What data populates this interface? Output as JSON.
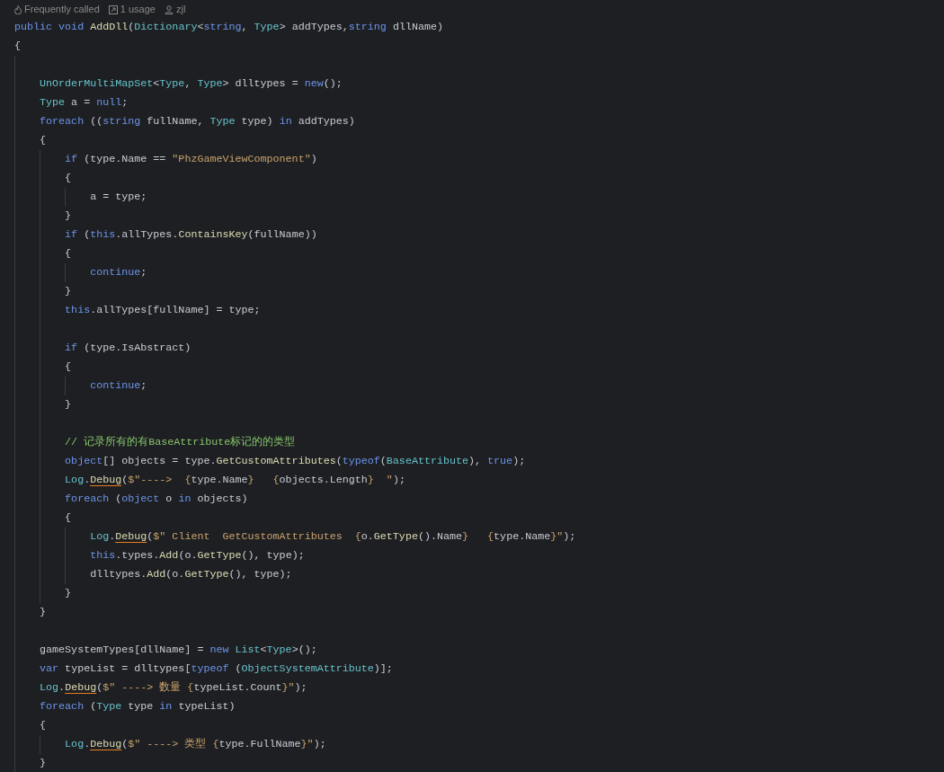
{
  "hints": [
    {
      "text": "Frequently called"
    },
    {
      "text": "1 usage"
    },
    {
      "text": "zjl"
    }
  ],
  "lines": [
    {
      "kind": "code",
      "tokens": [
        {
          "text": "public void ",
          "kind": "keyword"
        },
        {
          "text": "AddDll",
          "kind": "method"
        },
        {
          "text": "(",
          "kind": "plain"
        },
        {
          "text": "Dictionary",
          "kind": "type"
        },
        {
          "text": "<",
          "kind": "plain"
        },
        {
          "text": "string",
          "kind": "keyword"
        },
        {
          "text": ", ",
          "kind": "plain"
        },
        {
          "text": "Type",
          "kind": "type"
        },
        {
          "text": "> addTypes,",
          "kind": "plain"
        },
        {
          "text": "string",
          "kind": "keyword"
        },
        {
          "text": " dllName)",
          "kind": "plain"
        }
      ]
    },
    {
      "kind": "code",
      "tokens": [
        {
          "text": "{",
          "kind": "plain"
        }
      ]
    },
    {
      "kind": "blank"
    },
    {
      "kind": "code",
      "tokens": [
        {
          "text": "    UnOrderMultiMapSet",
          "kind": "type"
        },
        {
          "text": "<",
          "kind": "plain"
        },
        {
          "text": "Type",
          "kind": "type"
        },
        {
          "text": ", ",
          "kind": "plain"
        },
        {
          "text": "Type",
          "kind": "type"
        },
        {
          "text": "> dlltypes = ",
          "kind": "plain"
        },
        {
          "text": "new",
          "kind": "keyword"
        },
        {
          "text": "();",
          "kind": "plain"
        }
      ]
    },
    {
      "kind": "code",
      "tokens": [
        {
          "text": "    Type",
          "kind": "type"
        },
        {
          "text": " a = ",
          "kind": "plain"
        },
        {
          "text": "null",
          "kind": "keyword"
        },
        {
          "text": ";",
          "kind": "plain"
        }
      ]
    },
    {
      "kind": "code",
      "tokens": [
        {
          "text": "    foreach",
          "kind": "keyword"
        },
        {
          "text": " ((",
          "kind": "plain"
        },
        {
          "text": "string",
          "kind": "keyword"
        },
        {
          "text": " fullName, ",
          "kind": "plain"
        },
        {
          "text": "Type",
          "kind": "type"
        },
        {
          "text": " type) ",
          "kind": "plain"
        },
        {
          "text": "in",
          "kind": "keyword"
        },
        {
          "text": " addTypes)",
          "kind": "plain"
        }
      ]
    },
    {
      "kind": "code",
      "tokens": [
        {
          "text": "    {",
          "kind": "plain"
        }
      ]
    },
    {
      "kind": "code",
      "tokens": [
        {
          "text": "        if",
          "kind": "keyword"
        },
        {
          "text": " (type.Name == ",
          "kind": "plain"
        },
        {
          "text": "\"PhzGameViewComponent\"",
          "kind": "string"
        },
        {
          "text": ")",
          "kind": "plain"
        }
      ]
    },
    {
      "kind": "code",
      "tokens": [
        {
          "text": "        {",
          "kind": "plain"
        }
      ]
    },
    {
      "kind": "code",
      "tokens": [
        {
          "text": "            a = type;",
          "kind": "plain"
        }
      ]
    },
    {
      "kind": "code",
      "tokens": [
        {
          "text": "        }",
          "kind": "plain"
        }
      ]
    },
    {
      "kind": "code",
      "tokens": [
        {
          "text": "        if",
          "kind": "keyword"
        },
        {
          "text": " (",
          "kind": "plain"
        },
        {
          "text": "this",
          "kind": "keyword"
        },
        {
          "text": ".allTypes.",
          "kind": "plain"
        },
        {
          "text": "ContainsKey",
          "kind": "method"
        },
        {
          "text": "(fullName))",
          "kind": "plain"
        }
      ]
    },
    {
      "kind": "code",
      "tokens": [
        {
          "text": "        {",
          "kind": "plain"
        }
      ]
    },
    {
      "kind": "code",
      "tokens": [
        {
          "text": "            continue",
          "kind": "keyword"
        },
        {
          "text": ";",
          "kind": "plain"
        }
      ]
    },
    {
      "kind": "code",
      "tokens": [
        {
          "text": "        }",
          "kind": "plain"
        }
      ]
    },
    {
      "kind": "code",
      "tokens": [
        {
          "text": "        this",
          "kind": "keyword"
        },
        {
          "text": ".allTypes[fullName] = type;",
          "kind": "plain"
        }
      ]
    },
    {
      "kind": "blank"
    },
    {
      "kind": "code",
      "tokens": [
        {
          "text": "        if",
          "kind": "keyword"
        },
        {
          "text": " (type.IsAbstract)",
          "kind": "plain"
        }
      ]
    },
    {
      "kind": "code",
      "tokens": [
        {
          "text": "        {",
          "kind": "plain"
        }
      ]
    },
    {
      "kind": "code",
      "tokens": [
        {
          "text": "            continue",
          "kind": "keyword"
        },
        {
          "text": ";",
          "kind": "plain"
        }
      ]
    },
    {
      "kind": "code",
      "tokens": [
        {
          "text": "        }",
          "kind": "plain"
        }
      ]
    },
    {
      "kind": "blank"
    },
    {
      "kind": "code",
      "tokens": [
        {
          "text": "        // 记录所有的有BaseAttribute标记的的类型",
          "kind": "comment"
        }
      ]
    },
    {
      "kind": "code",
      "tokens": [
        {
          "text": "        object",
          "kind": "keyword"
        },
        {
          "text": "[] objects = type.",
          "kind": "plain"
        },
        {
          "text": "GetCustomAttributes",
          "kind": "method"
        },
        {
          "text": "(",
          "kind": "plain"
        },
        {
          "text": "typeof",
          "kind": "keyword"
        },
        {
          "text": "(",
          "kind": "plain"
        },
        {
          "text": "BaseAttribute",
          "kind": "type"
        },
        {
          "text": "), ",
          "kind": "plain"
        },
        {
          "text": "true",
          "kind": "keyword"
        },
        {
          "text": ");",
          "kind": "plain"
        }
      ]
    },
    {
      "kind": "code",
      "tokens": [
        {
          "text": "        Log",
          "kind": "type"
        },
        {
          "text": ".",
          "kind": "plain"
        },
        {
          "text": "Debug",
          "kind": "method",
          "warning": true
        },
        {
          "text": "(",
          "kind": "plain"
        },
        {
          "text": "$\"---->  {",
          "kind": "string"
        },
        {
          "text": "type.Name",
          "kind": "plain"
        },
        {
          "text": "}   {",
          "kind": "string"
        },
        {
          "text": "objects.Length",
          "kind": "plain"
        },
        {
          "text": "}  \"",
          "kind": "string"
        },
        {
          "text": ");",
          "kind": "plain"
        }
      ]
    },
    {
      "kind": "code",
      "tokens": [
        {
          "text": "        foreach",
          "kind": "keyword"
        },
        {
          "text": " (",
          "kind": "plain"
        },
        {
          "text": "object",
          "kind": "keyword"
        },
        {
          "text": " o ",
          "kind": "plain"
        },
        {
          "text": "in",
          "kind": "keyword"
        },
        {
          "text": " objects)",
          "kind": "plain"
        }
      ]
    },
    {
      "kind": "code",
      "tokens": [
        {
          "text": "        {",
          "kind": "plain"
        }
      ]
    },
    {
      "kind": "code",
      "tokens": [
        {
          "text": "            Log",
          "kind": "type"
        },
        {
          "text": ".",
          "kind": "plain"
        },
        {
          "text": "Debug",
          "kind": "method",
          "warning": true
        },
        {
          "text": "(",
          "kind": "plain"
        },
        {
          "text": "$\" Client  GetCustomAttributes  {",
          "kind": "string"
        },
        {
          "text": "o.",
          "kind": "plain"
        },
        {
          "text": "GetType",
          "kind": "method"
        },
        {
          "text": "().Name",
          "kind": "plain"
        },
        {
          "text": "}   {",
          "kind": "string"
        },
        {
          "text": "type.Name",
          "kind": "plain"
        },
        {
          "text": "}\"",
          "kind": "string"
        },
        {
          "text": ");",
          "kind": "plain"
        }
      ]
    },
    {
      "kind": "code",
      "tokens": [
        {
          "text": "            this",
          "kind": "keyword"
        },
        {
          "text": ".types.",
          "kind": "plain"
        },
        {
          "text": "Add",
          "kind": "method"
        },
        {
          "text": "(o.",
          "kind": "plain"
        },
        {
          "text": "GetType",
          "kind": "method"
        },
        {
          "text": "(), type);",
          "kind": "plain"
        }
      ]
    },
    {
      "kind": "code",
      "tokens": [
        {
          "text": "            dlltypes.",
          "kind": "plain"
        },
        {
          "text": "Add",
          "kind": "method"
        },
        {
          "text": "(o.",
          "kind": "plain"
        },
        {
          "text": "GetType",
          "kind": "method"
        },
        {
          "text": "(), type);",
          "kind": "plain"
        }
      ]
    },
    {
      "kind": "code",
      "tokens": [
        {
          "text": "        }",
          "kind": "plain"
        }
      ]
    },
    {
      "kind": "code",
      "tokens": [
        {
          "text": "    }",
          "kind": "plain"
        }
      ]
    },
    {
      "kind": "blank"
    },
    {
      "kind": "code",
      "tokens": [
        {
          "text": "    gameSystemTypes[dllName] = ",
          "kind": "plain"
        },
        {
          "text": "new",
          "kind": "keyword"
        },
        {
          "text": " List",
          "kind": "type"
        },
        {
          "text": "<",
          "kind": "plain"
        },
        {
          "text": "Type",
          "kind": "type"
        },
        {
          "text": ">();",
          "kind": "plain"
        }
      ]
    },
    {
      "kind": "code",
      "tokens": [
        {
          "text": "    var",
          "kind": "keyword"
        },
        {
          "text": " typeList = dlltypes[",
          "kind": "plain"
        },
        {
          "text": "typeof",
          "kind": "keyword"
        },
        {
          "text": " (",
          "kind": "plain"
        },
        {
          "text": "ObjectSystemAttribute",
          "kind": "type"
        },
        {
          "text": ")];",
          "kind": "plain"
        }
      ]
    },
    {
      "kind": "code",
      "tokens": [
        {
          "text": "    Log",
          "kind": "type"
        },
        {
          "text": ".",
          "kind": "plain"
        },
        {
          "text": "Debug",
          "kind": "method",
          "warning": true
        },
        {
          "text": "(",
          "kind": "plain"
        },
        {
          "text": "$\" ----> 数量 {",
          "kind": "string"
        },
        {
          "text": "typeList.Count",
          "kind": "plain"
        },
        {
          "text": "}\"",
          "kind": "string"
        },
        {
          "text": ");",
          "kind": "plain"
        }
      ]
    },
    {
      "kind": "code",
      "tokens": [
        {
          "text": "    foreach",
          "kind": "keyword"
        },
        {
          "text": " (",
          "kind": "plain"
        },
        {
          "text": "Type",
          "kind": "type"
        },
        {
          "text": " type ",
          "kind": "plain"
        },
        {
          "text": "in",
          "kind": "keyword"
        },
        {
          "text": " typeList)",
          "kind": "plain"
        }
      ]
    },
    {
      "kind": "code",
      "tokens": [
        {
          "text": "    {",
          "kind": "plain"
        }
      ]
    },
    {
      "kind": "code",
      "tokens": [
        {
          "text": "        Log",
          "kind": "type"
        },
        {
          "text": ".",
          "kind": "plain"
        },
        {
          "text": "Debug",
          "kind": "method",
          "warning": true
        },
        {
          "text": "(",
          "kind": "plain"
        },
        {
          "text": "$\" ----> 类型 {",
          "kind": "string"
        },
        {
          "text": "type.FullName",
          "kind": "plain"
        },
        {
          "text": "}\"",
          "kind": "string"
        },
        {
          "text": ");",
          "kind": "plain"
        }
      ]
    },
    {
      "kind": "code",
      "tokens": [
        {
          "text": "    }",
          "kind": "plain"
        }
      ]
    }
  ]
}
